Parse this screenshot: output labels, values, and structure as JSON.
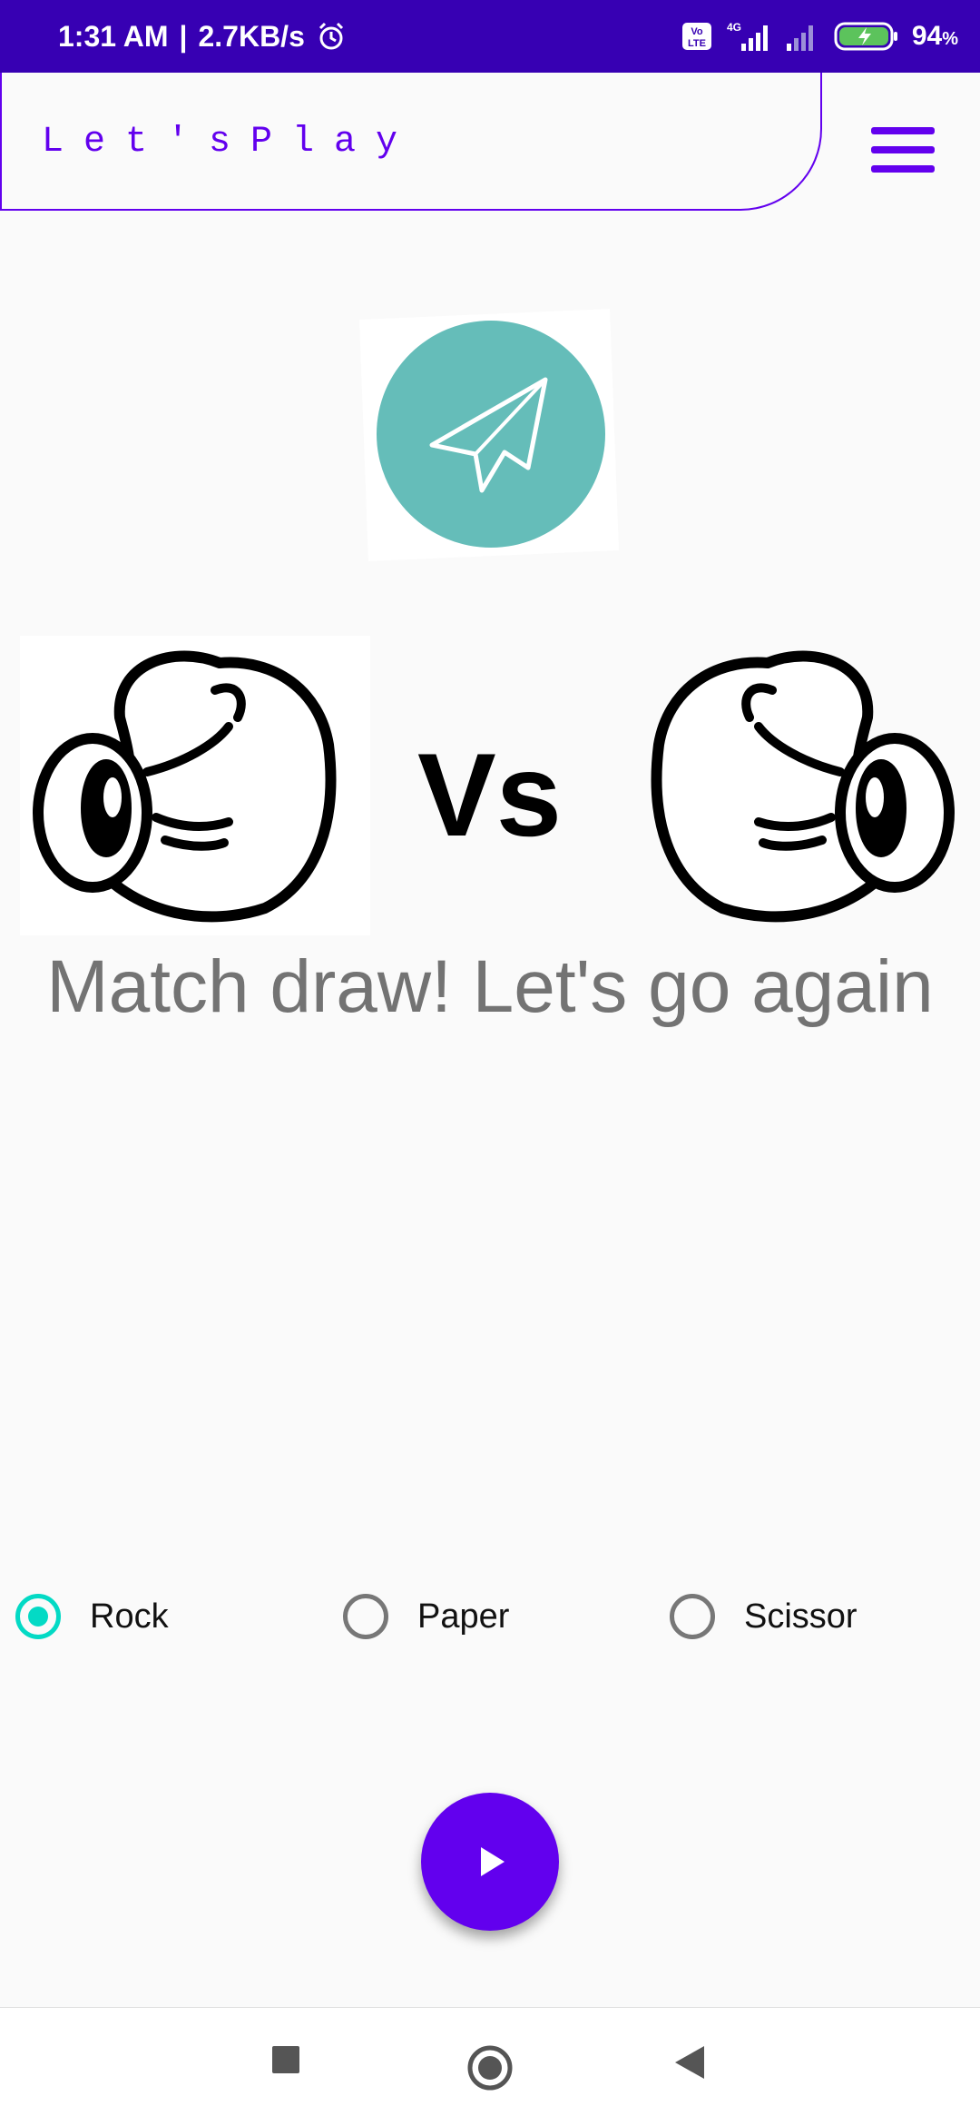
{
  "status_bar": {
    "time": "1:31 AM",
    "speed": "2.7KB/s",
    "battery": "94",
    "battery_unit": "%",
    "icons": [
      "alarm-icon",
      "volte-icon",
      "signal-4g-icon",
      "signal-icon",
      "battery-charging-icon"
    ]
  },
  "app_bar": {
    "title": "Let'sPlay",
    "menu_icon": "hamburger-menu-icon"
  },
  "logo_icon": "paper-plane-logo",
  "vs_label": "Vs",
  "player_choice_icon": "rock-fist-icon",
  "computer_choice_icon": "rock-fist-icon",
  "result_message": "Match draw! Let's go again",
  "options": [
    {
      "label": "Rock",
      "checked": true
    },
    {
      "label": "Paper",
      "checked": false
    },
    {
      "label": "Scissor",
      "checked": false
    }
  ],
  "fab_icon": "play-icon",
  "nav": [
    "recents-icon",
    "home-icon",
    "back-icon"
  ],
  "colors": {
    "primary": "#6200ee",
    "status_bar": "#3700b3",
    "accent": "#03dac5",
    "logo_bg": "#65bdb9",
    "result_text": "#737373"
  }
}
